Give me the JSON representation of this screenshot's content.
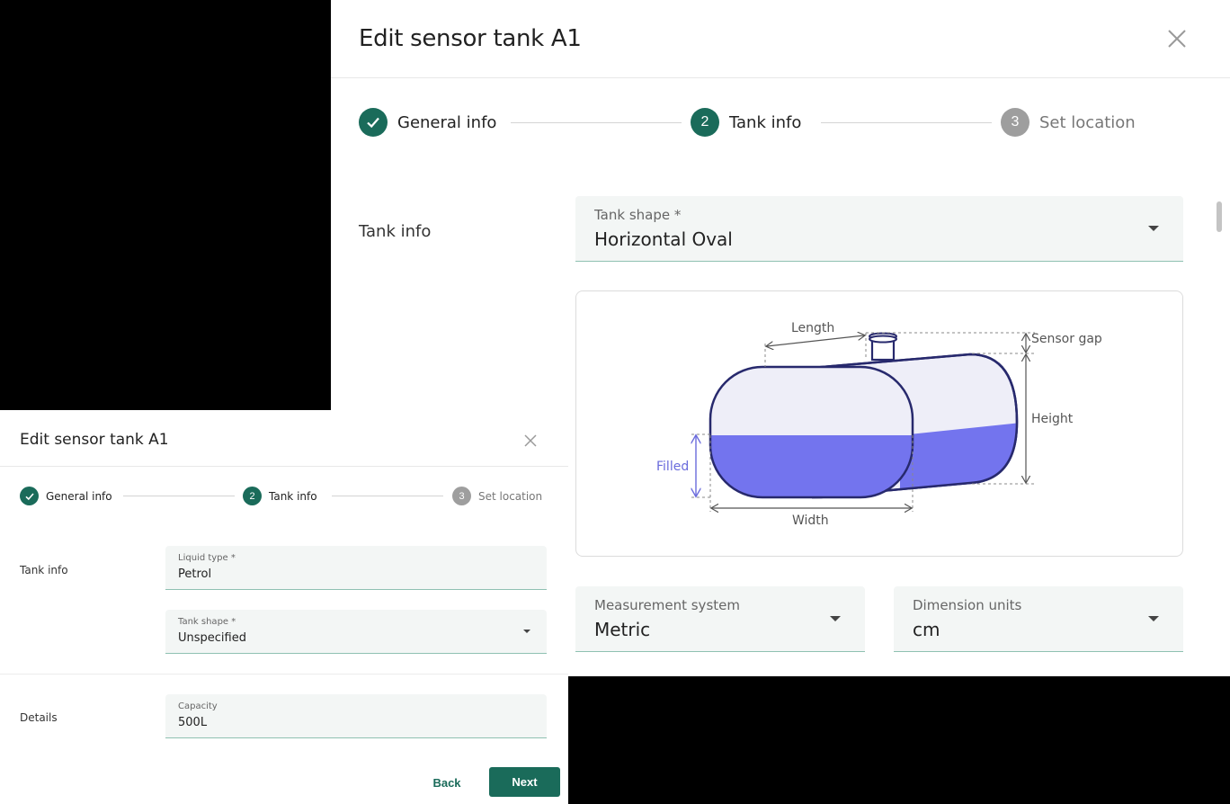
{
  "big_dialog": {
    "title": "Edit sensor tank A1",
    "steps": [
      {
        "number": "1",
        "label": "General info",
        "state": "completed"
      },
      {
        "number": "2",
        "label": "Tank info",
        "state": "active"
      },
      {
        "number": "3",
        "label": "Set location",
        "state": "pending"
      }
    ],
    "section_label": "Tank info",
    "tank_shape": {
      "label": "Tank shape *",
      "value": "Horizontal Oval"
    },
    "diagram": {
      "length": "Length",
      "sensor_gap": "Sensor gap",
      "height": "Height",
      "filled": "Filled",
      "width": "Width"
    },
    "measurement_system": {
      "label": "Measurement system",
      "value": "Metric"
    },
    "dimension_units": {
      "label": "Dimension units",
      "value": "cm"
    }
  },
  "small_dialog": {
    "title": "Edit sensor tank A1",
    "steps": [
      {
        "number": "1",
        "label": "General info",
        "state": "completed"
      },
      {
        "number": "2",
        "label": "Tank info",
        "state": "active"
      },
      {
        "number": "3",
        "label": "Set location",
        "state": "pending"
      }
    ],
    "tank_info_label": "Tank info",
    "liquid_type": {
      "label": "Liquid type *",
      "value": "Petrol"
    },
    "tank_shape": {
      "label": "Tank shape *",
      "value": "Unspecified"
    },
    "details_label": "Details",
    "capacity": {
      "label": "Capacity",
      "value": "500L"
    },
    "back_label": "Back",
    "next_label": "Next"
  },
  "colors": {
    "accent": "#1a6b5a",
    "step_pending": "#9e9e9e",
    "tank_outline": "#27296d",
    "tank_fill": "#7374ee",
    "tank_empty": "#eeeef8",
    "filled_label": "#6a6bdc"
  },
  "icons": {
    "close": "close-icon",
    "check": "check-icon",
    "dropdown": "chevron-down-icon"
  }
}
